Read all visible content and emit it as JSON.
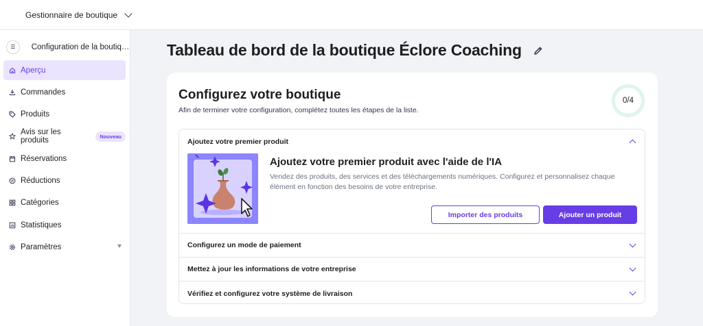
{
  "topbar": {
    "store_switcher_label": "Gestionnaire de boutique"
  },
  "sidebar": {
    "setup_label": "Configuration de la boutique...",
    "items": [
      {
        "label": "Aperçu",
        "icon": "home-icon",
        "active": true
      },
      {
        "label": "Commandes",
        "icon": "download-icon"
      },
      {
        "label": "Produits",
        "icon": "tag-icon"
      },
      {
        "label": "Avis sur les produits",
        "icon": "star-icon",
        "badge": "Nouveau"
      },
      {
        "label": "Réservations",
        "icon": "calendar-icon"
      },
      {
        "label": "Réductions",
        "icon": "discount-icon"
      },
      {
        "label": "Catégories",
        "icon": "grid-icon"
      },
      {
        "label": "Statistiques",
        "icon": "chart-icon"
      },
      {
        "label": "Paramètres",
        "icon": "gear-icon",
        "expandable": true
      }
    ]
  },
  "main": {
    "page_title": "Tableau de bord de la boutique Éclore Coaching",
    "card": {
      "title": "Configurez votre boutique",
      "subtitle": "Afin de terminer votre configuration, complétez toutes les étapes de la liste.",
      "progress": "0/4",
      "steps": [
        {
          "title": "Ajoutez votre premier produit",
          "expanded": true,
          "body_title": "Ajoutez votre premier produit avec l'aide de l'IA",
          "body_desc": "Vendez des produits, des services et des téléchargements numériques. Configurez et personnalisez chaque élément en fonction des besoins de votre entreprise.",
          "secondary_button": "Importer des produits",
          "primary_button": "Ajouter un produit"
        },
        {
          "title": "Configurez un mode de paiement"
        },
        {
          "title": "Mettez à jour les informations de votre entreprise"
        },
        {
          "title": "Vérifiez et configurez votre système de livraison"
        }
      ]
    }
  },
  "colors": {
    "accent": "#673de6",
    "accent_light": "#ebe4ff",
    "progress_ring": "#def4f0",
    "illustration_bg": "#8c85ff"
  }
}
